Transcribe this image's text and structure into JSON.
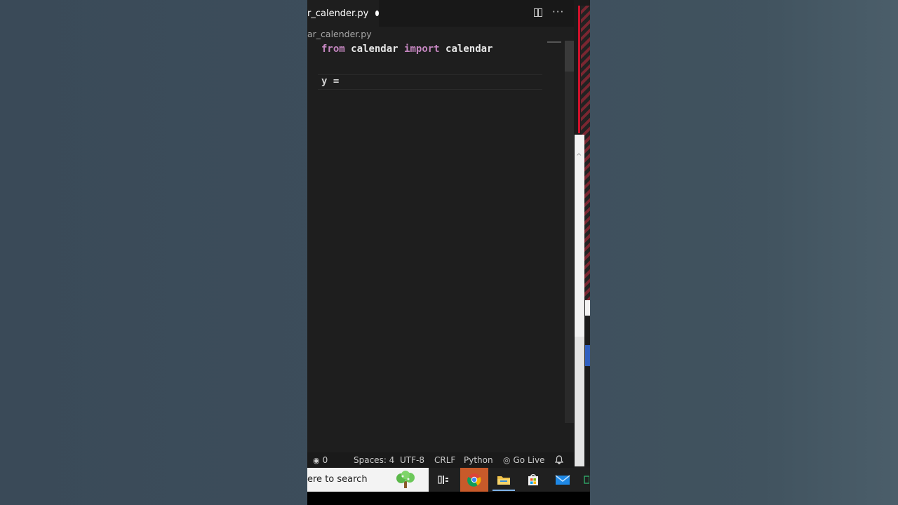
{
  "editor_tab": {
    "filename": "r_calender.py"
  },
  "breadcrumb": {
    "path": "ar_calender.py"
  },
  "code": {
    "line1": {
      "kw1": "from",
      "mod": "calendar",
      "kw2": "import",
      "name": "calendar"
    },
    "line2": {
      "text": "y ="
    }
  },
  "statusbar": {
    "ports": "0",
    "spaces": "Spaces: 4",
    "encoding": "UTF-8",
    "eol": "CRLF",
    "language": "Python",
    "golive": "Go Live"
  },
  "taskbar": {
    "search_text": "ere to search"
  },
  "colors": {
    "keyword": "#c586c0",
    "editor_bg": "#1e1e1e",
    "accent_red": "#d0112b"
  }
}
